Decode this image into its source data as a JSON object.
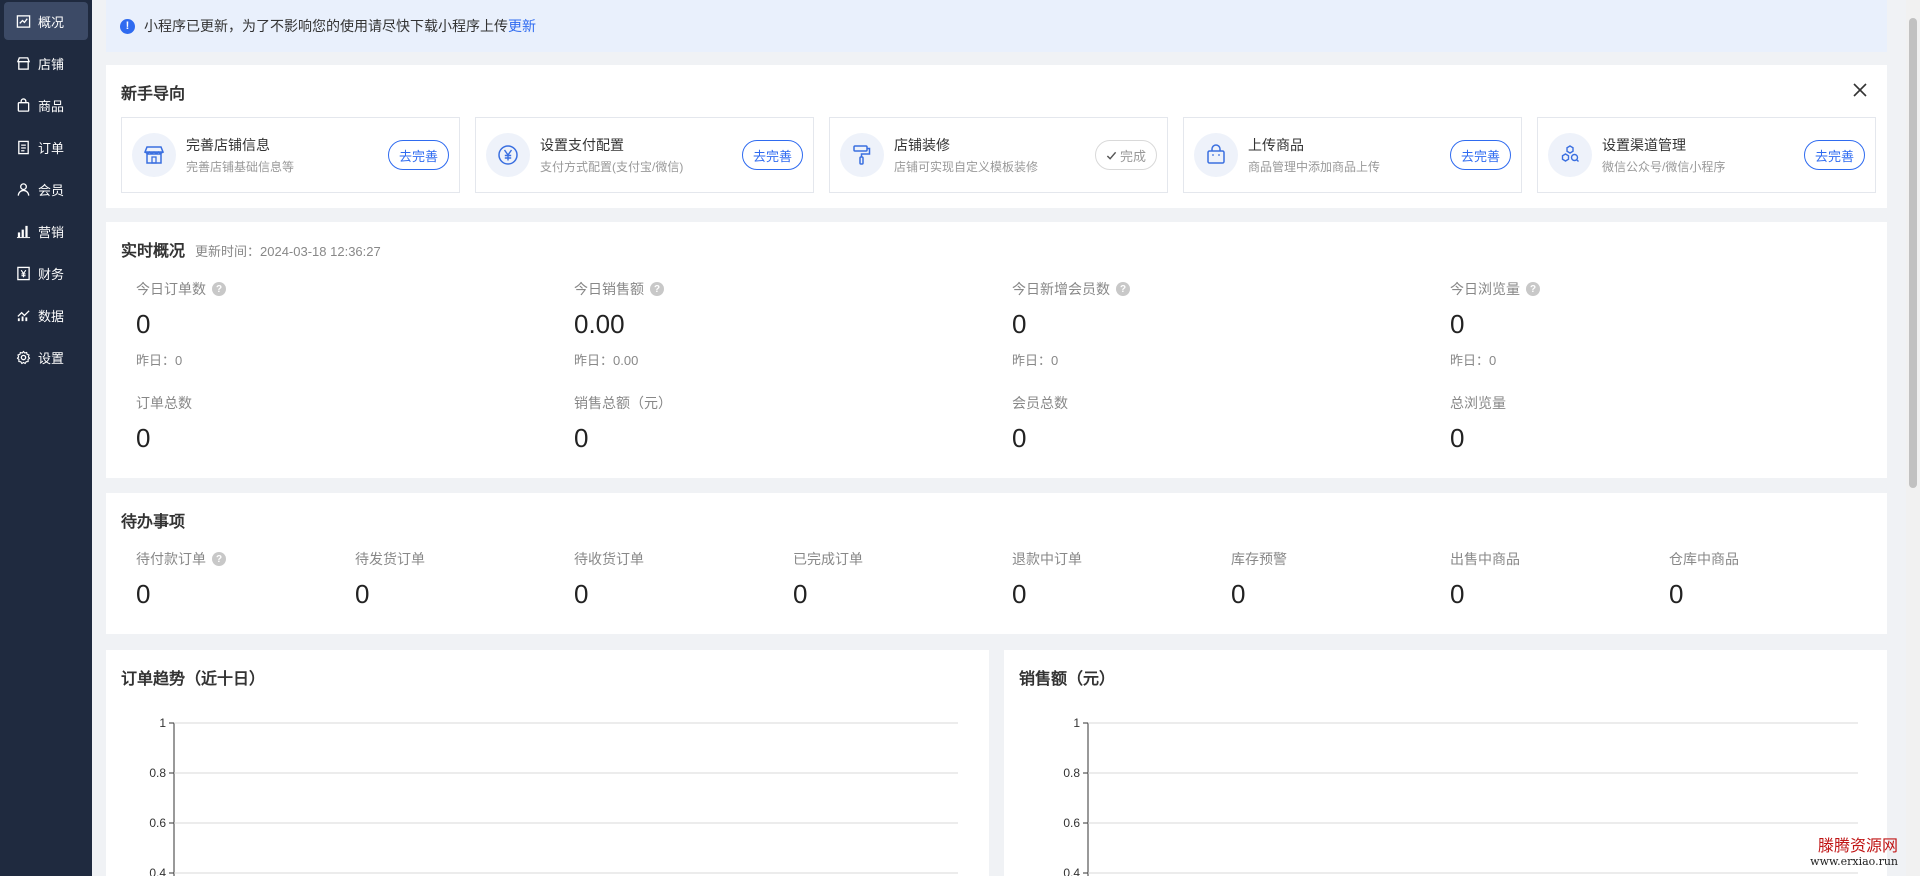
{
  "sidebar": {
    "items": [
      {
        "label": "概况",
        "icon": "chart-line-icon"
      },
      {
        "label": "店铺",
        "icon": "store-icon"
      },
      {
        "label": "商品",
        "icon": "bag-icon"
      },
      {
        "label": "订单",
        "icon": "document-icon"
      },
      {
        "label": "会员",
        "icon": "user-icon"
      },
      {
        "label": "营销",
        "icon": "bar-chart-icon"
      },
      {
        "label": "财务",
        "icon": "yen-icon"
      },
      {
        "label": "数据",
        "icon": "data-chart-icon"
      },
      {
        "label": "设置",
        "icon": "gear-icon"
      }
    ]
  },
  "notice": {
    "text": "小程序已更新，为了不影响您的使用请尽快下载小程序上传",
    "link": "更新"
  },
  "guide": {
    "title": "新手导向",
    "items": [
      {
        "title": "完善店铺信息",
        "desc": "完善店铺基础信息等",
        "button": "去完善",
        "icon": "storefront-icon"
      },
      {
        "title": "设置支付配置",
        "desc": "支付方式配置(支付宝/微信)",
        "button": "去完善",
        "icon": "yen-circle-icon"
      },
      {
        "title": "店铺装修",
        "desc": "店铺可实现自定义模板装修",
        "button": "完成",
        "icon": "paint-roller-icon"
      },
      {
        "title": "上传商品",
        "desc": "商品管理中添加商品上传",
        "button": "去完善",
        "icon": "shopping-bag-icon"
      },
      {
        "title": "设置渠道管理",
        "desc": "微信公众号/微信小程序",
        "button": "去完善",
        "icon": "hexagon-channels-icon"
      }
    ]
  },
  "realtime": {
    "title": "实时概况",
    "updated": "更新时间：2024-03-18 12:36:27",
    "today": [
      {
        "label": "今日订单数",
        "value": "0",
        "yesterday": "昨日：0"
      },
      {
        "label": "今日销售额",
        "value": "0.00",
        "yesterday": "昨日：0.00"
      },
      {
        "label": "今日新增会员数",
        "value": "0",
        "yesterday": "昨日：0"
      },
      {
        "label": "今日浏览量",
        "value": "0",
        "yesterday": "昨日：0"
      }
    ],
    "totals": [
      {
        "label": "订单总数",
        "value": "0"
      },
      {
        "label": "销售总额（元）",
        "value": "0"
      },
      {
        "label": "会员总数",
        "value": "0"
      },
      {
        "label": "总浏览量",
        "value": "0"
      }
    ]
  },
  "todo": {
    "title": "待办事项",
    "items": [
      {
        "label": "待付款订单",
        "value": "0"
      },
      {
        "label": "待发货订单",
        "value": "0"
      },
      {
        "label": "待收货订单",
        "value": "0"
      },
      {
        "label": "已完成订单",
        "value": "0"
      },
      {
        "label": "退款中订单",
        "value": "0"
      },
      {
        "label": "库存预警",
        "value": "0"
      },
      {
        "label": "出售中商品",
        "value": "0"
      },
      {
        "label": "仓库中商品",
        "value": "0"
      }
    ]
  },
  "colors": {
    "sidebar_bg": "#1f2a3f",
    "accent": "#2f6bf0",
    "page_bg": "#f0f2f5"
  },
  "watermark": {
    "line1": "滕腾资源网",
    "line2": "www.erxiao.run"
  },
  "chart_data": [
    {
      "type": "line",
      "title": "订单趋势（近十日）",
      "y_ticks": [
        "1",
        "0.8",
        "0.6",
        "0.4"
      ],
      "ylim": [
        0,
        1
      ],
      "grid": true,
      "series": []
    },
    {
      "type": "line",
      "title": "销售额（元）",
      "y_ticks": [
        "1",
        "0.8",
        "0.6",
        "0.4"
      ],
      "ylim": [
        0,
        1
      ],
      "grid": true,
      "series": []
    }
  ]
}
